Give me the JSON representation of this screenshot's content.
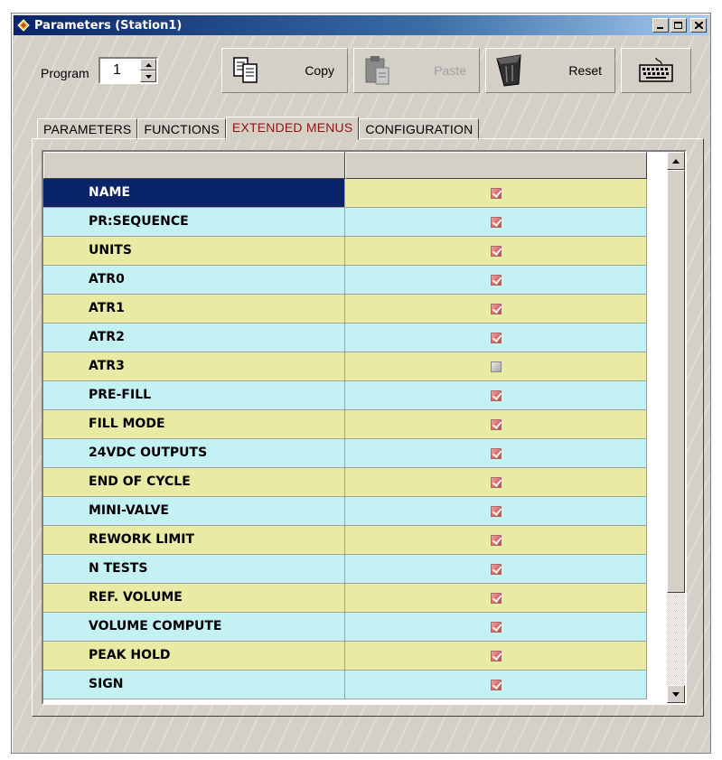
{
  "window": {
    "title": "Parameters (Station1)"
  },
  "toolbar": {
    "program_label": "Program",
    "program_value": "1",
    "copy_label": "Copy",
    "paste_label": "Paste",
    "reset_label": "Reset"
  },
  "tabs": [
    {
      "label": "PARAMETERS",
      "active": false
    },
    {
      "label": "FUNCTIONS",
      "active": false
    },
    {
      "label": "EXTENDED MENUS",
      "active": true
    },
    {
      "label": "CONFIGURATION",
      "active": false
    }
  ],
  "grid": {
    "rows": [
      {
        "name": "NAME",
        "checked": true,
        "selected": true
      },
      {
        "name": "PR:SEQUENCE",
        "checked": true
      },
      {
        "name": "UNITS",
        "checked": true
      },
      {
        "name": "ATR0",
        "checked": true
      },
      {
        "name": "ATR1",
        "checked": true
      },
      {
        "name": "ATR2",
        "checked": true
      },
      {
        "name": "ATR3",
        "checked": false
      },
      {
        "name": "PRE-FILL",
        "checked": true
      },
      {
        "name": "FILL MODE",
        "checked": true
      },
      {
        "name": "24VDC OUTPUTS",
        "checked": true
      },
      {
        "name": "END OF CYCLE",
        "checked": true
      },
      {
        "name": "MINI-VALVE",
        "checked": true
      },
      {
        "name": "REWORK LIMIT",
        "checked": true
      },
      {
        "name": "N TESTS",
        "checked": true
      },
      {
        "name": "REF. VOLUME",
        "checked": true
      },
      {
        "name": "VOLUME COMPUTE",
        "checked": true
      },
      {
        "name": "PEAK HOLD",
        "checked": true
      },
      {
        "name": "SIGN",
        "checked": true
      }
    ]
  },
  "colors": {
    "row_yellow": "#e9eba4",
    "row_cyan": "#c4f1f4",
    "selected": "#0a246a",
    "active_tab_text": "#8b1414"
  }
}
